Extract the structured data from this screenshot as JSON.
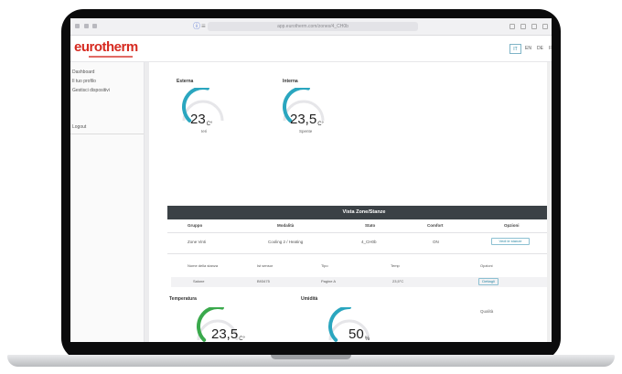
{
  "browser": {
    "url": "app.eurotherm.com/zones/4_CH0b",
    "nav_glyphs": [
      "⌂",
      "‹",
      "›"
    ],
    "reader_glyph": "ⓘ",
    "tools_glyph": "≡"
  },
  "header": {
    "logo": "eurotherm",
    "buttons": [
      "IT",
      "EN",
      "DE",
      "FR"
    ],
    "active_button": 0
  },
  "sidebar": {
    "items": [
      "Dashboard",
      "Il tuo profilo",
      "Gestisci dispositivi"
    ],
    "footer_item": "Logout"
  },
  "cards_top": [
    {
      "title": "Esterna",
      "value": "23",
      "unit": "C°",
      "caption": "Ieri",
      "level": 0.55,
      "color": "#2aa6bf"
    },
    {
      "title": "Interna",
      "value": "23,5",
      "unit": "C°",
      "caption": "Spente",
      "level": 0.55,
      "color": "#2aa6bf"
    }
  ],
  "zone_table": {
    "title": "Vista Zone/Stanze",
    "headers": [
      "Gruppo",
      "Modalità",
      "Stato",
      "Comfort",
      "Opzioni"
    ],
    "row": {
      "gruppo": "Zone Vinti",
      "modalita": "Cooling 2 / Heating",
      "stato": "4_CH0b",
      "comfort": "ON",
      "option": "Vedi le stanze"
    },
    "sub_headers": [
      "Nome della stanza",
      "Ist sensor",
      "Tipo",
      "Temp",
      "Opzioni"
    ],
    "sub_row": {
      "nome": "Salone",
      "sensor": "B93475",
      "tipo": "Pagine A",
      "temp": "23,5°C",
      "option": "Dettagli"
    }
  },
  "cards_bottom": [
    {
      "title": "Temperatura",
      "value": "23,5",
      "unit": "C°",
      "level": 0.55,
      "color": "#3aa94c"
    },
    {
      "title": "Umidità",
      "value": "50",
      "unit": "%",
      "level": 0.5,
      "color": "#2aa6bf"
    }
  ],
  "right_panel": {
    "label": "Qualità"
  }
}
